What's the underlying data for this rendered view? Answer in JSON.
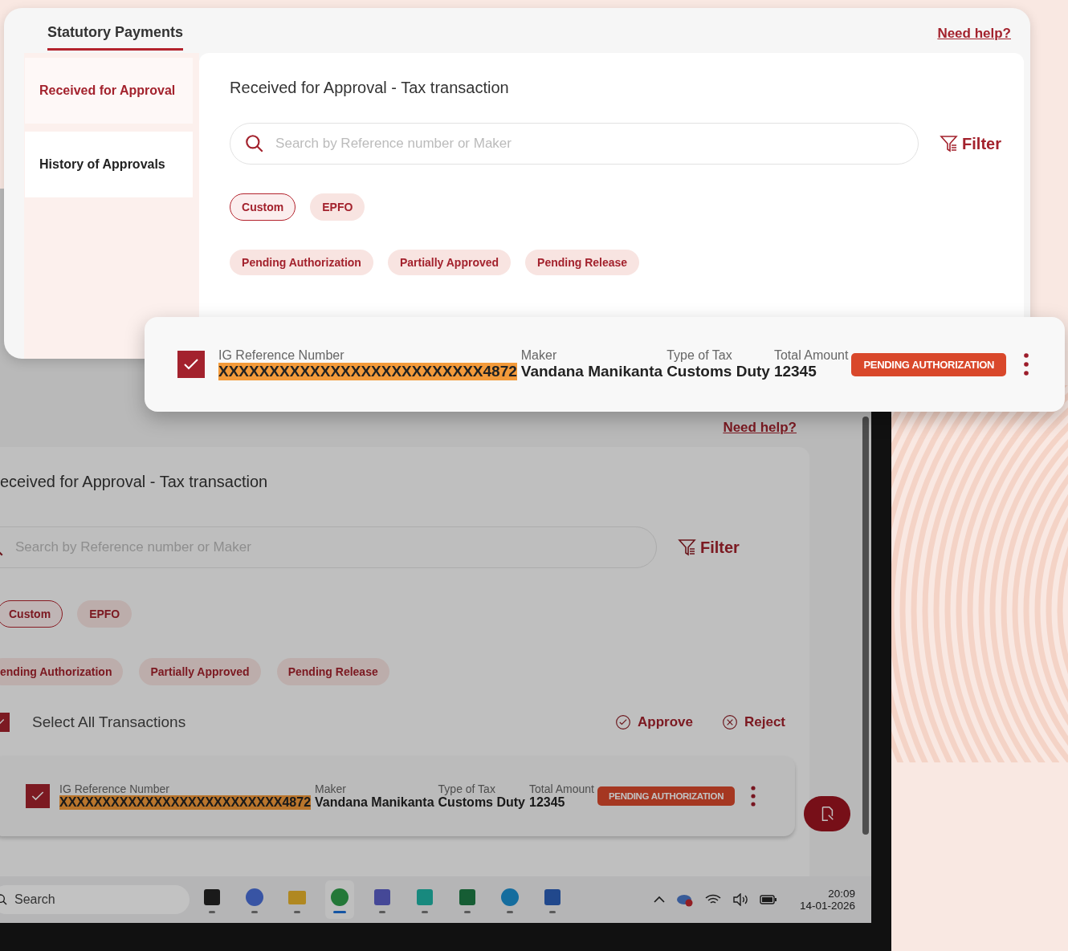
{
  "back_screen": {
    "help_link": "Need help?",
    "title": "eceived for Approval - Tax transaction",
    "search": {
      "placeholder": "Search by Reference number or Maker"
    },
    "filter": "Filter",
    "type_chips": [
      {
        "label": "Custom",
        "selected": true
      },
      {
        "label": "EPFO",
        "selected": false
      }
    ],
    "status_chips": [
      "ending Authorization",
      "Partially Approved",
      "Pending Release"
    ],
    "select_all": {
      "label": "Select All Transactions",
      "checked": true
    },
    "actions": [
      {
        "kind": "approve",
        "label": "Approve"
      },
      {
        "kind": "reject",
        "label": "Reject"
      }
    ],
    "transaction": {
      "checked": true,
      "columns": [
        {
          "label": "IG Reference Number",
          "value": "XXXXXXXXXXXXXXXXXXXXXXXXXX**4872**",
          "highlight": true
        },
        {
          "label": "Maker",
          "value": "Vandana Manikanta",
          "highlight": false
        },
        {
          "label": "Type of Tax",
          "value": "Customs Duty",
          "highlight": false
        },
        {
          "label": "Total Amount",
          "value": "12345",
          "highlight": false
        }
      ],
      "status": "PENDING AUTHORIZATION"
    },
    "taskbar": {
      "search": "Search",
      "apps": [
        {
          "kind": "taskview",
          "selected": false
        },
        {
          "kind": "copilot",
          "selected": false
        },
        {
          "kind": "folder",
          "selected": false
        },
        {
          "kind": "browser",
          "selected": true
        },
        {
          "kind": "chat",
          "selected": false
        },
        {
          "kind": "ide",
          "selected": false
        },
        {
          "kind": "sheet",
          "selected": false
        },
        {
          "kind": "edge",
          "selected": false
        },
        {
          "kind": "doc",
          "selected": false
        }
      ],
      "time": "20:09",
      "date": "14-01-2026"
    }
  },
  "front_panel": {
    "tab": "Statutory Payments",
    "help_link": "Need help?",
    "sidebar": [
      {
        "label": "Received for Approval",
        "selected": true
      },
      {
        "label": "History of Approvals",
        "selected": false
      }
    ],
    "title": "Received for Approval - Tax transaction",
    "search": {
      "placeholder": "Search by Reference number or Maker"
    },
    "filter": "Filter",
    "type_chips": [
      {
        "label": "Custom",
        "selected": true
      },
      {
        "label": "EPFO",
        "selected": false
      }
    ],
    "status_chips": [
      "Pending Authorization",
      "Partially Approved",
      "Pending Release"
    ]
  },
  "popup_row": {
    "checked": true,
    "columns": [
      {
        "label": "IG Reference Number",
        "value": "XXXXXXXXXXXXXXXXXXXXXXXXXX**4872**",
        "highlight": true
      },
      {
        "label": "Maker",
        "value": "Vandana Manikanta",
        "highlight": false
      },
      {
        "label": "Type of Tax",
        "value": "Customs Duty",
        "highlight": false
      },
      {
        "label": "Total Amount",
        "value": "12345",
        "highlight": false
      }
    ],
    "status": "PENDING AUTHORIZATION"
  }
}
